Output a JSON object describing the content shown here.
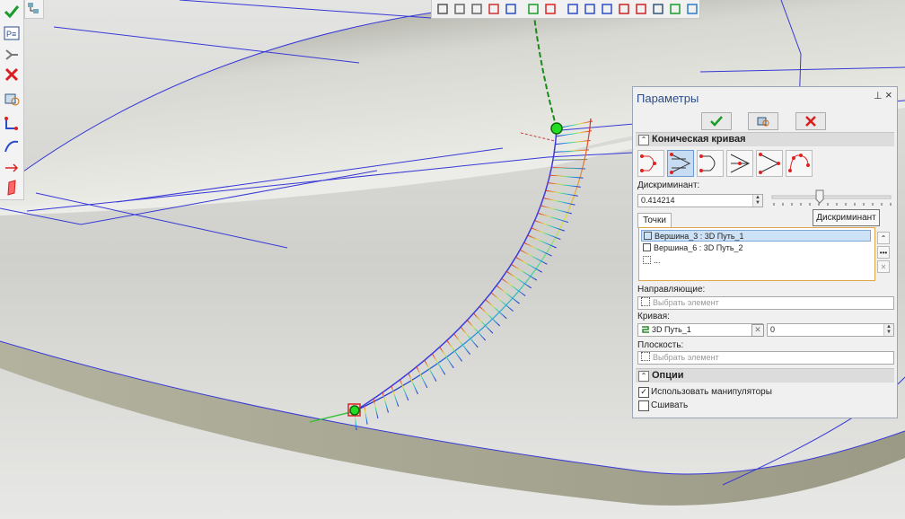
{
  "panel": {
    "title": "Параметры",
    "pin_glyph": "⊥",
    "close_glyph": "×",
    "actions": {
      "ok_icon": "check-icon",
      "preview_icon": "preview-icon",
      "cancel_icon": "cross-icon"
    },
    "section_conic": "Коническая кривая",
    "modes": [
      "point-tangent-point",
      "three-tangents",
      "two-lines",
      "parabola",
      "tangent-lines",
      "five-points"
    ],
    "selected_mode_index": 1,
    "discriminant_label": "Дискриминант:",
    "discriminant_value": "0.414214",
    "slider_tooltip": "Дискриминант",
    "points_tab": "Точки",
    "points": [
      {
        "label": "Вершина_3 : 3D Путь_1",
        "selected": true
      },
      {
        "label": "Вершина_6 : 3D Путь_2",
        "selected": false
      },
      {
        "label": "...",
        "selected": false
      }
    ],
    "guides_label": "Направляющие:",
    "guides_placeholder": "Выбрать элемент",
    "curve_label": "Кривая:",
    "curve_value": "3D Путь_1",
    "curve_param": "0",
    "plane_label": "Плоскость:",
    "plane_placeholder": "Выбрать элемент",
    "section_options": "Опции",
    "use_manipulators_label": "Использовать манипуляторы",
    "use_manipulators": true,
    "stitch_label": "Сшивать",
    "stitch": false
  },
  "left_toolbar": [
    "check-icon",
    "parameters-icon",
    "tree-icon",
    "cross-icon",
    "view-icon",
    "axis-icon",
    "curve-icon",
    "arrow-icon",
    "plane-icon"
  ],
  "top_toolbar": [
    "filter-icon",
    "filter2-icon",
    "filter3-icon",
    "select-icon",
    "axis-select-icon",
    "check-filter-icon",
    "cross-filter-icon",
    "coords-icon",
    "coords2-icon",
    "edge-icon",
    "face-icon",
    "face2-icon",
    "solid-icon",
    "path-icon",
    "body-icon"
  ],
  "colors": {
    "accent": "#2b4d88",
    "ok": "#1a9c2a",
    "cancel": "#d81e1e",
    "curve": "#3a3ae0"
  }
}
